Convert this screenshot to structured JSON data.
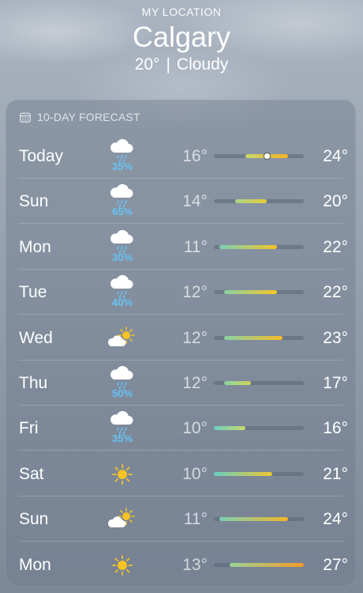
{
  "location": {
    "label": "MY LOCATION",
    "city": "Calgary",
    "current_temp": "20°",
    "separator": "|",
    "condition": "Cloudy"
  },
  "forecast": {
    "header": "10-DAY FORECAST",
    "header_icon": "calendar-icon",
    "scale_min": 10,
    "scale_max": 27,
    "current_temp_value": 20,
    "days": [
      {
        "day": "Today",
        "icon": "cloud-rain-icon",
        "precip": "35%",
        "low": "16°",
        "high": "24°",
        "low_val": 16,
        "high_val": 24
      },
      {
        "day": "Sun",
        "icon": "cloud-rain-icon",
        "precip": "65%",
        "low": "14°",
        "high": "20°",
        "low_val": 14,
        "high_val": 20
      },
      {
        "day": "Mon",
        "icon": "cloud-rain-icon",
        "precip": "30%",
        "low": "11°",
        "high": "22°",
        "low_val": 11,
        "high_val": 22
      },
      {
        "day": "Tue",
        "icon": "cloud-rain-icon",
        "precip": "40%",
        "low": "12°",
        "high": "22°",
        "low_val": 12,
        "high_val": 22
      },
      {
        "day": "Wed",
        "icon": "partly-cloudy-icon",
        "precip": "",
        "low": "12°",
        "high": "23°",
        "low_val": 12,
        "high_val": 23
      },
      {
        "day": "Thu",
        "icon": "cloud-rain-icon",
        "precip": "50%",
        "low": "12°",
        "high": "17°",
        "low_val": 12,
        "high_val": 17
      },
      {
        "day": "Fri",
        "icon": "cloud-rain-icon",
        "precip": "35%",
        "low": "10°",
        "high": "16°",
        "low_val": 10,
        "high_val": 16
      },
      {
        "day": "Sat",
        "icon": "sun-icon",
        "precip": "",
        "low": "10°",
        "high": "21°",
        "low_val": 10,
        "high_val": 21
      },
      {
        "day": "Sun",
        "icon": "partly-cloudy-icon",
        "precip": "",
        "low": "11°",
        "high": "24°",
        "low_val": 11,
        "high_val": 24
      },
      {
        "day": "Mon",
        "icon": "sun-icon",
        "precip": "",
        "low": "13°",
        "high": "27°",
        "low_val": 13,
        "high_val": 27
      }
    ]
  },
  "colors": {
    "precip_text": "#69c3f5",
    "sun": "#f7c325",
    "track": "#5a6676",
    "temp_cool": "#6ad0c0",
    "temp_mild": "#c8d86a",
    "temp_warm": "#f5c426",
    "temp_hot": "#f59a26"
  }
}
